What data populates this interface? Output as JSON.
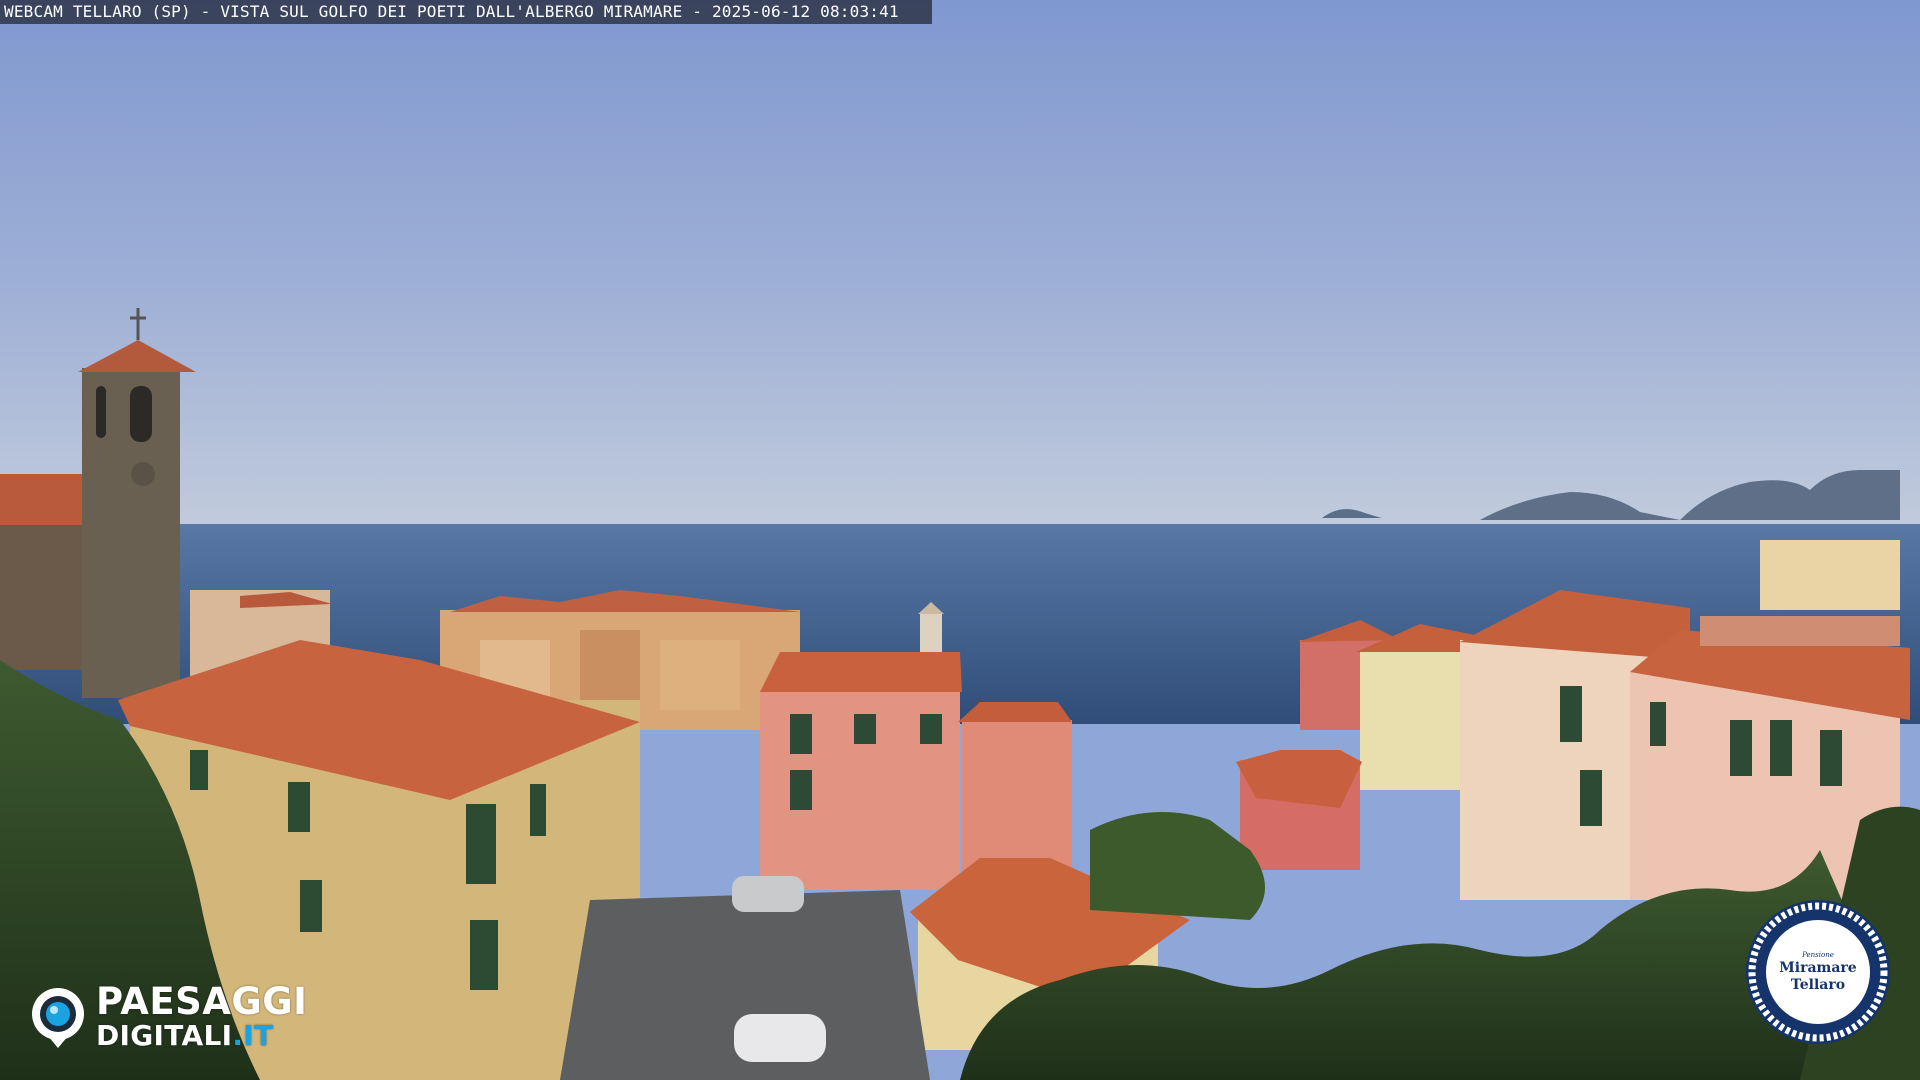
{
  "overlay": {
    "caption": "WEBCAM TELLARO (SP) - VISTA SUL GOLFO DEI POETI DALL'ALBERGO MIRAMARE - 2025-06-12 08:03:41"
  },
  "brand": {
    "line1": "PAESAGGI",
    "line2_main": "DIGITALI",
    "line2_tld": ".IT",
    "icon": "camera-eye-icon",
    "accent_color": "#1aa3e0"
  },
  "hotel_badge": {
    "small_label": "Pensione",
    "name_line1": "Miramare",
    "name_line2": "Tellaro",
    "ring_color": "#15346b"
  },
  "palette": {
    "sky_top": "#8099cf",
    "sky_horizon": "#bcc7d9",
    "sea": "#3d5d8a",
    "roof": "#c8613f"
  }
}
